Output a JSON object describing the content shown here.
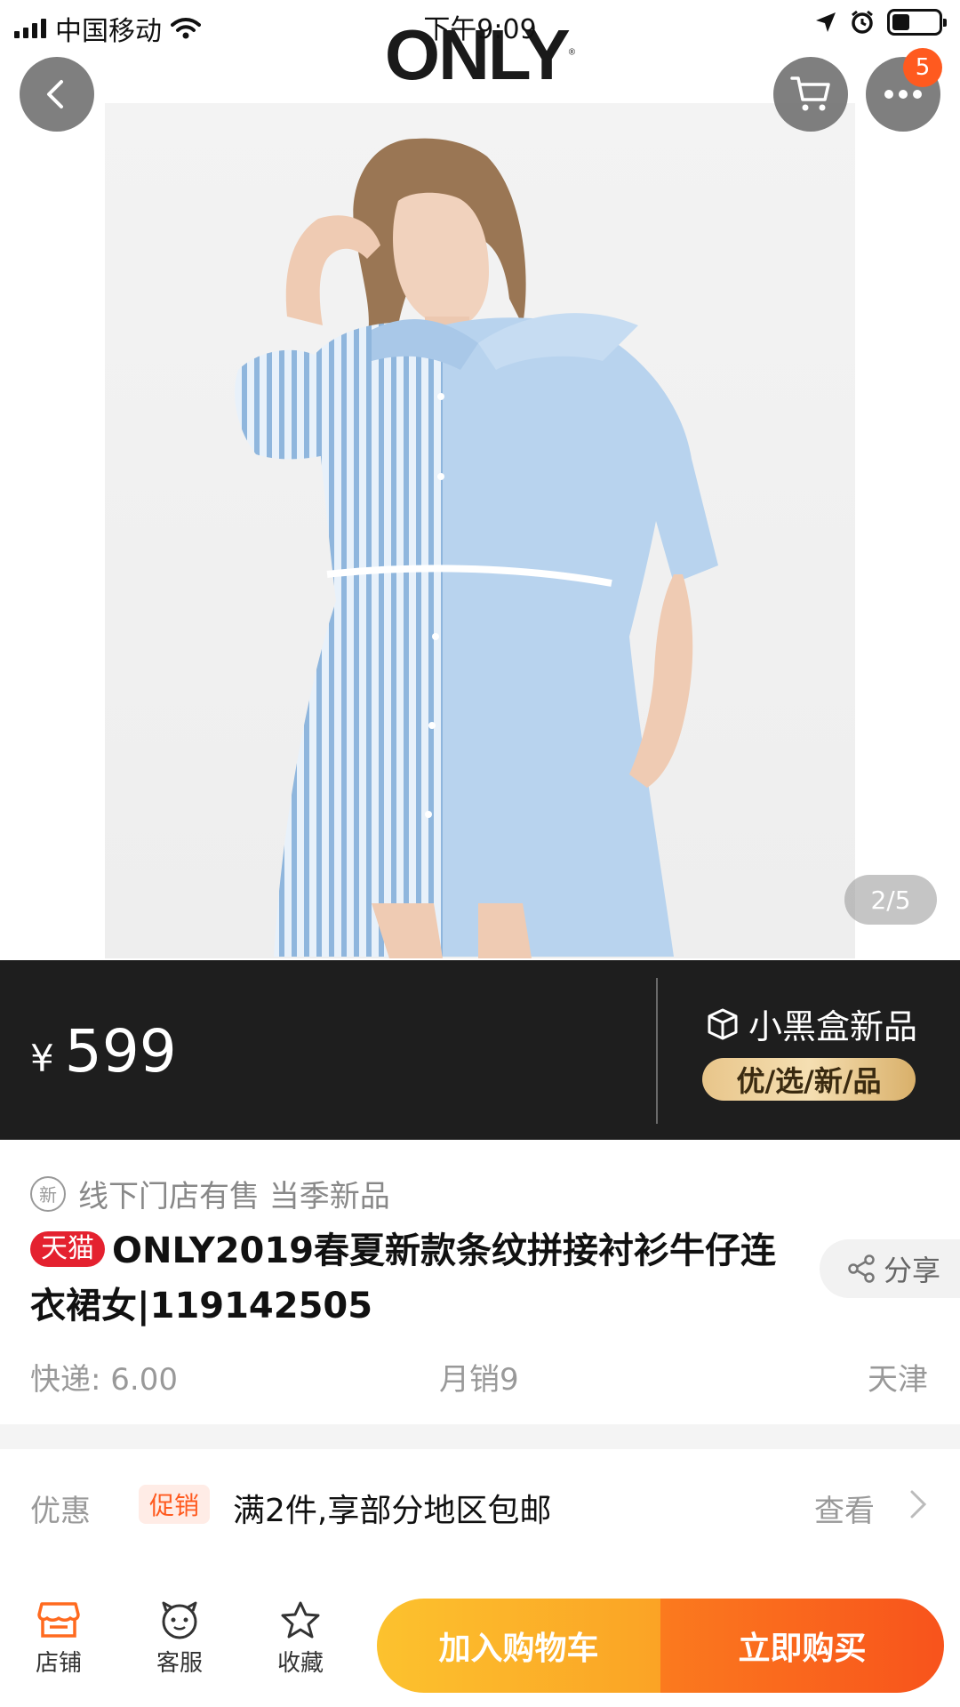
{
  "status_bar": {
    "carrier": "中国移动",
    "time": "下午9:09"
  },
  "header": {
    "brand": "ONLY",
    "cart_badge": "5"
  },
  "gallery": {
    "pager": "2/5"
  },
  "price_banner": {
    "currency": "¥",
    "price": "599",
    "black_box_label": "小黑盒新品",
    "selection_pill": "优/选/新/品"
  },
  "product": {
    "new_note": "线下门店有售 当季新品",
    "new_icon_text": "新",
    "tmall_tag": "天猫",
    "title": "ONLY2019春夏新款条纹拼接衬衫牛仔连衣裙女|119142505",
    "share_label": "分享",
    "shipping": "快递: 6.00",
    "monthly_sales": "月销9",
    "location": "天津"
  },
  "promotion": {
    "label": "优惠",
    "tag": "促销",
    "text": "满2件,享部分地区包邮",
    "view_label": "查看"
  },
  "bottom_bar": {
    "store_label": "店铺",
    "service_label": "客服",
    "favorite_label": "收藏",
    "add_to_cart_label": "加入购物车",
    "buy_now_label": "立即购买"
  },
  "colors": {
    "accent_orange": "#f8531c",
    "accent_yellow": "#fcc22e",
    "tmall_red": "#e4212f",
    "banner_dark": "#1e1e1e"
  }
}
